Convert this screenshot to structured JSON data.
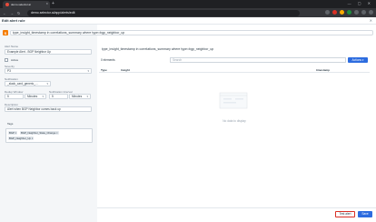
{
  "browser": {
    "tab_title": "demo.selector.ai",
    "url": "demo.selector.ai/app/alerts/edit"
  },
  "header": {
    "title": "Edit alert rule"
  },
  "query": {
    "text": "type_insight_timestamp in correlations_summary where type=bgp_neighbor_up"
  },
  "form": {
    "alert_name_label": "Alert Name",
    "alert_name_value": "Example Alert - BGP Neighbor Up",
    "active_label": "Active",
    "severity_label": "Severity",
    "severity_value": "P3",
    "notification_label": "Notification",
    "notification_value": "_slack_card_generic_...",
    "dedup_label": "Dedup Window",
    "dedup_value": "5",
    "dedup_unit": "Minutes",
    "notif_interval_label": "Notification Interval",
    "notif_interval_value": "5",
    "notif_interval_unit": "Minutes",
    "description_label": "Description",
    "description_value": "Alert when BGP Neighbor comes back up",
    "tags_label": "Tags",
    "tags": [
      "BGP",
      "BGP_Neighbor_State_Change",
      "BGP_Neighbor_Up"
    ]
  },
  "results": {
    "query_title": "type_insight_timestamp in correlations_summary where type=bgp_neighbor_up",
    "count": "0 elements",
    "search_placeholder": "Search",
    "actions_label": "Actions",
    "columns": [
      "Type",
      "Insight",
      "timestamp"
    ],
    "empty_text": "No data to display"
  },
  "footer": {
    "test_label": "Test alert",
    "save_label": "Save"
  }
}
